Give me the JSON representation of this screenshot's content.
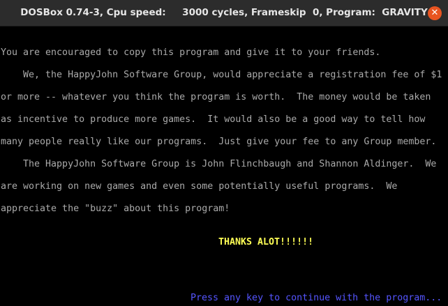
{
  "window": {
    "title": "DOSBox 0.74-3, Cpu speed:     3000 cycles, Frameskip  0, Program:  GRAVITY"
  },
  "colors": {
    "text": "#aaaaaa",
    "thanks": "#ffff55",
    "prompt": "#5555ff",
    "close_button": "#e95420"
  },
  "screen": {
    "lines": [
      "You are encouraged to copy this program and give it to your friends.",
      "    We, the HappyJohn Software Group, would appreciate a registration fee of $1",
      "or more -- whatever you think the program is worth.  The money would be taken",
      "as incentive to produce more games.  It would also be a good way to tell how",
      "many people really like our programs.  Just give your fee to any Group member.",
      "    The HappyJohn Software Group is John Flinchbaugh and Shannon Aldinger.  We",
      "are working on new games and even some potentially useful programs.  We",
      "appreciate the \"buzz\" about this program!"
    ],
    "thanks": "THANKS ALOT!!!!!!",
    "prompt": "Press any key to continue with the program..."
  }
}
